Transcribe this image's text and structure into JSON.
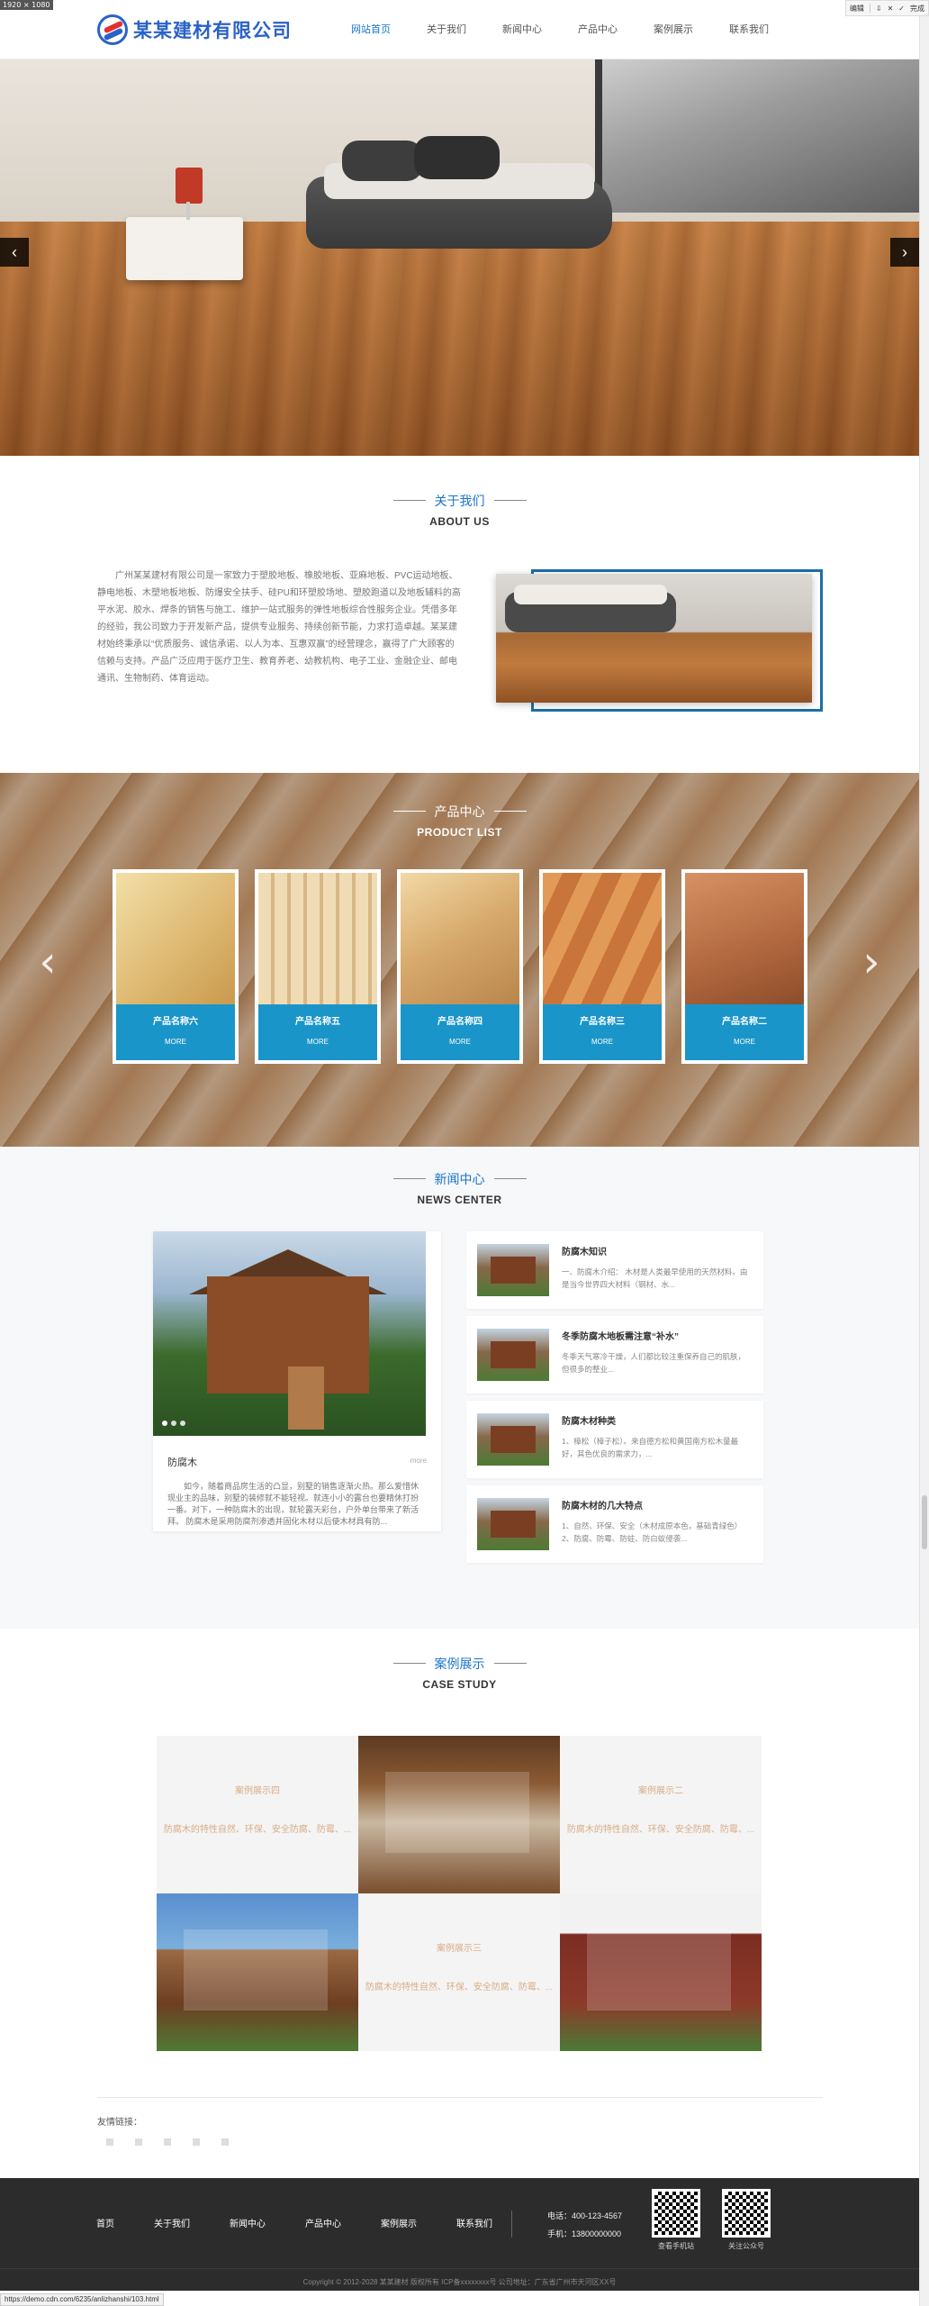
{
  "viewport_badge": "1920 × 1080",
  "editor_toolbar": {
    "edit_label": "编辑",
    "done_label": "完成"
  },
  "header": {
    "logo_text": "某某建材有限公司",
    "nav": [
      "网站首页",
      "关于我们",
      "新闻中心",
      "产品中心",
      "案例展示",
      "联系我们"
    ],
    "active_index": 0,
    "accent_color": "#1a73c9"
  },
  "banner": {
    "prev_arrow": "‹",
    "next_arrow": "›"
  },
  "about": {
    "title_cn": "关于我们",
    "title_en": "ABOUT US",
    "body": "广州某某建材有限公司是一家致力于塑胶地板、橡胶地板、亚麻地板、PVC运动地板、静电地板、木塑地板地板、防爆安全扶手、硅PU和环塑胶场地、塑胶跑道以及地板辅料的高平水泥、胶水、焊条的销售与施工、维护一站式服务的弹性地板综合性服务企业。凭借多年的经验，我公司致力于开发新产品，提供专业服务、持续创新节能，力求打造卓越。某某建材始终秉承以“优质服务、诚信承诺、以人为本、互惠双赢”的经营理念，赢得了广大顾客的信赖与支持。产品广泛应用于医疗卫生、教育养老、幼教机构、电子工业、金融企业、邮电通讯、生物制药、体育运动。"
  },
  "products": {
    "title_cn": "产品中心",
    "title_en": "PRODUCT LIST",
    "prev_arrow": "‹",
    "next_arrow": "›",
    "items": [
      {
        "name": "产品名称六",
        "more": "MORE",
        "color": "#e8c98a"
      },
      {
        "name": "产品名称五",
        "more": "MORE",
        "color": "#e2c69a"
      },
      {
        "name": "产品名称四",
        "more": "MORE",
        "color": "#d6a66a"
      },
      {
        "name": "产品名称三",
        "more": "MORE",
        "color": "#c8783c"
      },
      {
        "name": "产品名称二",
        "more": "MORE",
        "color": "#b87046"
      }
    ],
    "caption_color": "#1a95c9"
  },
  "news": {
    "title_cn": "新闻中心",
    "title_en": "NEWS CENTER",
    "feature": {
      "title": "防腐木",
      "more": "more",
      "desc": "如今，随着商品房生活的凸显，别墅的销售逐渐火热。那么爱惜休现业主的品味，别墅的装修就不能轻视。就连小小的露台也要精休打扮一番。对下，一种防腐木的出现，就轮露天彩台，户外单台带来了新活拜。 防腐木是采用防腐剂渗透并固化木材以后使木材具有防..."
    },
    "items": [
      {
        "title": "防腐木知识",
        "desc": "一、防腐木介绍： 木材是人类最早使用的天然材料。由是当今世界四大材料（钢材、水..."
      },
      {
        "title": "冬季防腐木地板需注意“补水”",
        "desc": "冬季天气寒冷干燥，人们都比较注重保养自己的肌肤，但很多的整业..."
      },
      {
        "title": "防腐木材种类",
        "desc": "1、樟松（樟子松）。来自德方松和黄国南方松木量最好，其色优良的需求力，..."
      },
      {
        "title": "防腐木材的几大特点",
        "desc": "1、自然、环保、安全（木材成原本色，基础青绿色）2、防腐、防霉、防蛀、防白蚁侵袭..."
      }
    ]
  },
  "cases": {
    "title_cn": "案例展示",
    "title_en": "CASE STUDY",
    "items": [
      {
        "name": "案例展示四",
        "desc": "防腐木的特性自然、环保、安全防腐、防霉、..."
      },
      {
        "name": "案例展示二",
        "desc": "防腐木的特性自然、环保、安全防腐、防霉、..."
      },
      {
        "name": "案例展示三",
        "desc": "防腐木的特性自然、环保、安全防腐、防霉、..."
      }
    ]
  },
  "links": {
    "label": "友情链接："
  },
  "footer": {
    "nav": [
      "首页",
      "关于我们",
      "新闻中心",
      "产品中心",
      "案例展示",
      "联系我们"
    ],
    "phone": "电话：400-123-4567",
    "mobile": "手机：13800000000",
    "qr1_label": "查看手机站",
    "qr2_label": "关注公众号",
    "copyright": "Copyright © 2012-2028 某某建材 版权所有 ICP备xxxxxxxx号 公司地址：广东省广州市天河区XX号"
  },
  "statusbar": "https://demo.cdn.com/6235/anlizhanshi/103.html"
}
